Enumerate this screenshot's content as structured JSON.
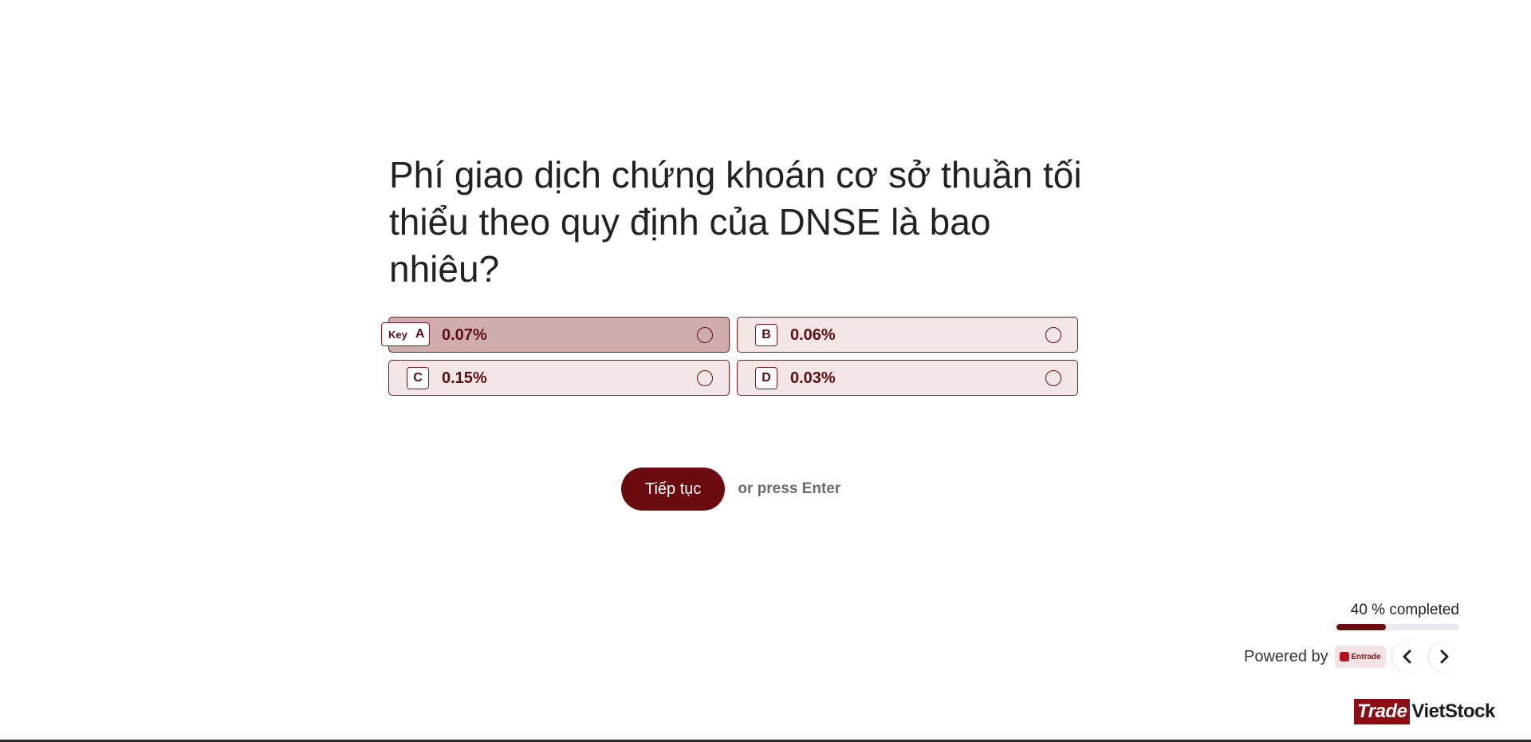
{
  "question": {
    "text": "Phí giao dịch chứng khoán cơ sở thuần tối thiểu theo quy định của DNSE là bao nhiêu?"
  },
  "options": [
    {
      "letter": "A",
      "text": "0.07%",
      "selected": true,
      "key_label": "Key"
    },
    {
      "letter": "B",
      "text": "0.06%",
      "selected": false
    },
    {
      "letter": "C",
      "text": "0.15%",
      "selected": false
    },
    {
      "letter": "D",
      "text": "0.03%",
      "selected": false
    }
  ],
  "actions": {
    "continue_label": "Tiếp tục",
    "enter_hint": "or press Enter"
  },
  "progress": {
    "label": "40 % completed",
    "percent": 40
  },
  "footer": {
    "powered_by": "Powered by",
    "logo_text": "Entrade",
    "prev_icon": "chevron-left-icon",
    "next_icon": "chevron-right-icon"
  },
  "watermark": {
    "part1": "Trade",
    "part2": "VietStock"
  },
  "colors": {
    "accent": "#6b0a0f",
    "option_bg": "#f2e6e6",
    "option_selected_bg": "#cfadaf",
    "border": "#7a1a1f"
  }
}
